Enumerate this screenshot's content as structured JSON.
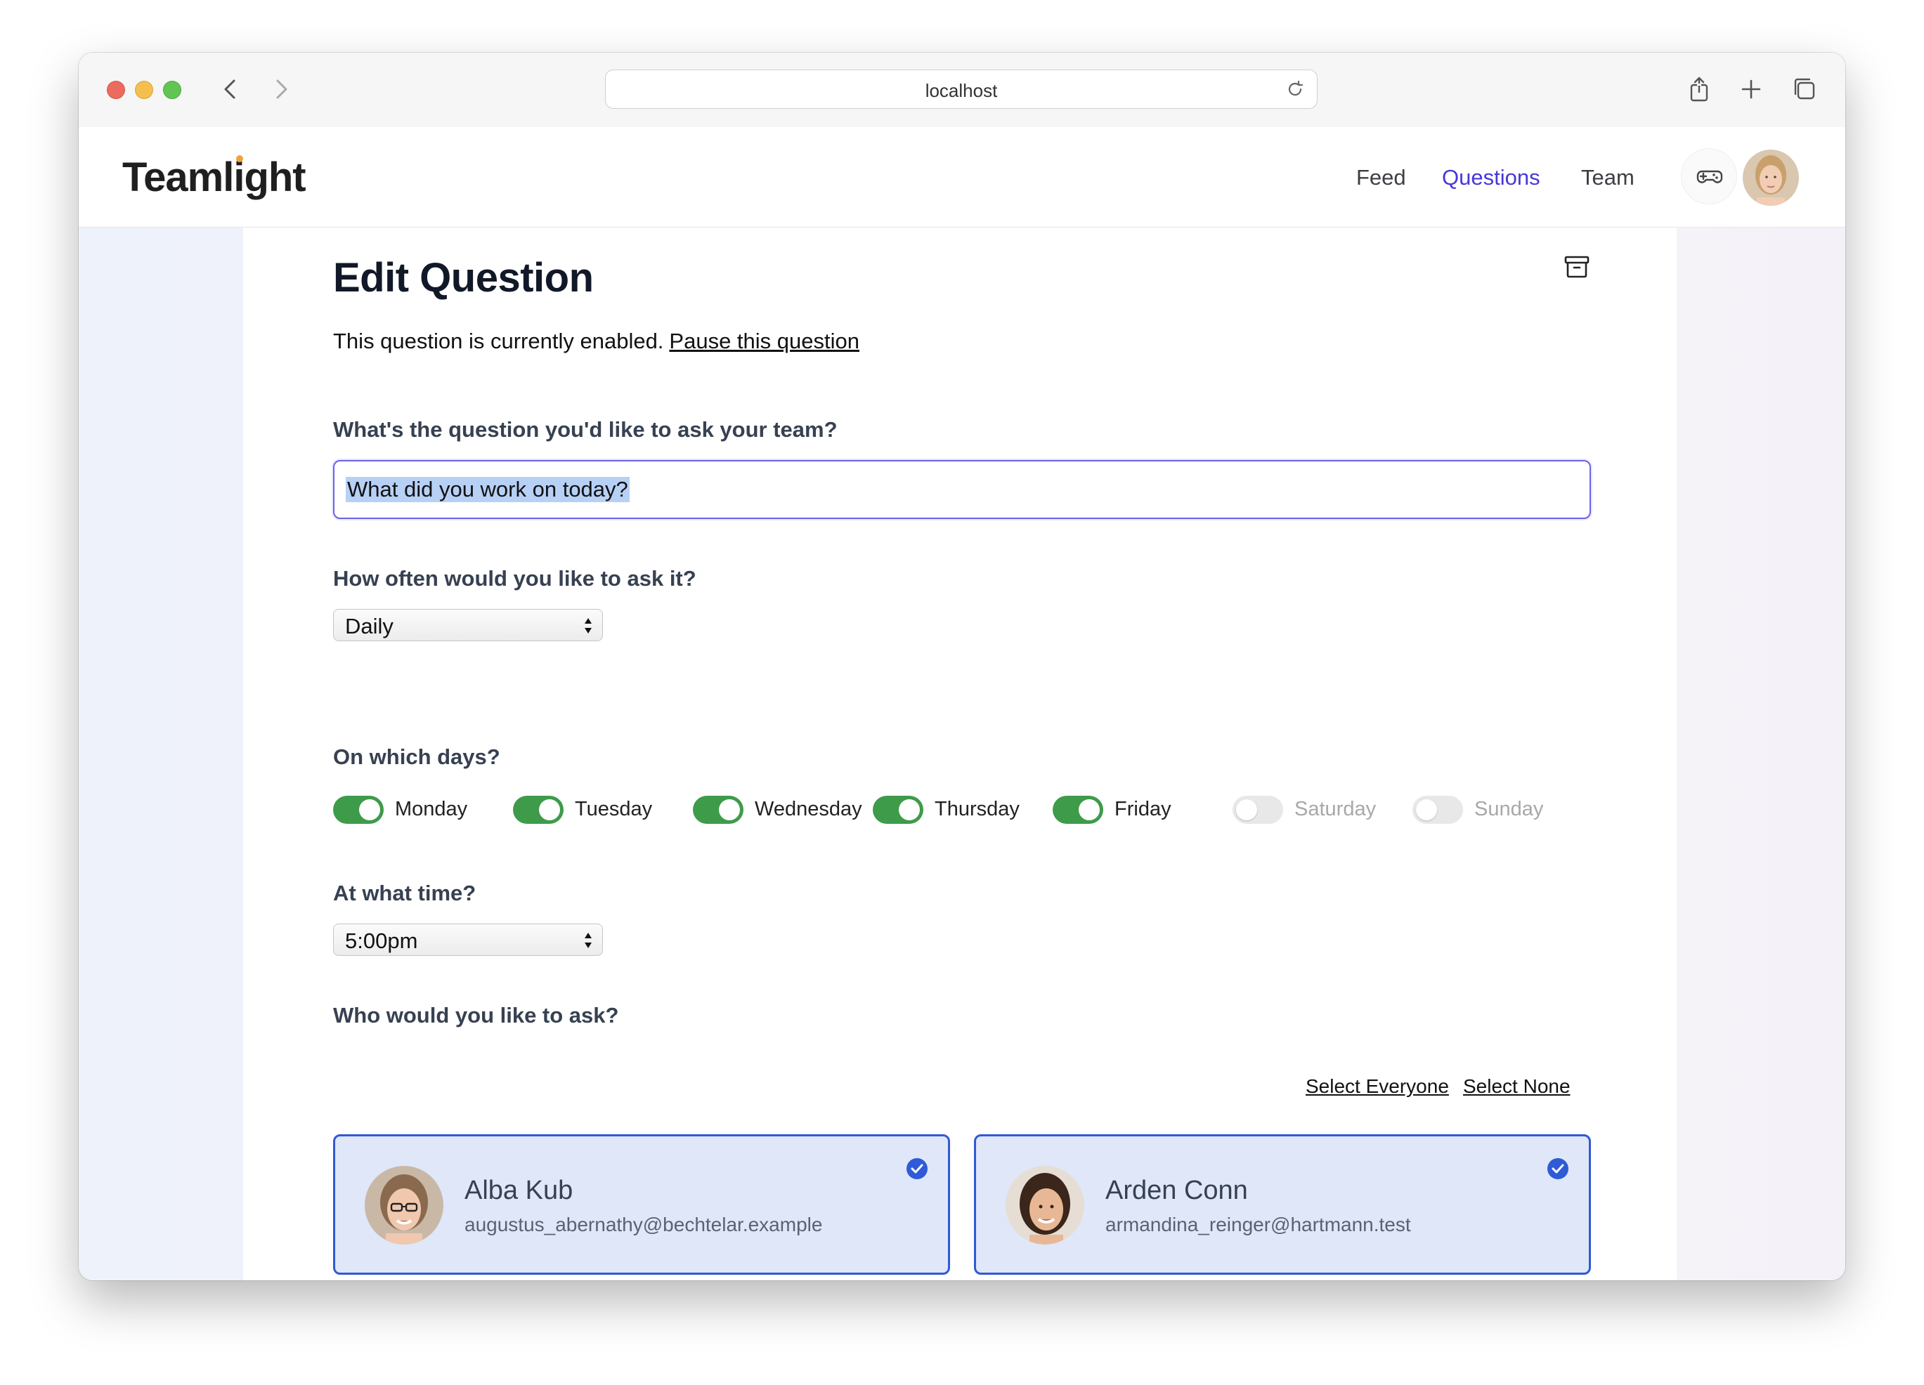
{
  "browser": {
    "url": "localhost"
  },
  "header": {
    "logo": "Teamlight",
    "nav": {
      "feed": "Feed",
      "questions": "Questions",
      "team": "Team"
    },
    "active_color": "#4638d8"
  },
  "page": {
    "title": "Edit Question",
    "status_text": "This question is currently enabled.",
    "pause_link": "Pause this question",
    "question_label": "What's the question you'd like to ask your team?",
    "question_value": "What did you work on today?",
    "frequency_label": "How often would you like to ask it?",
    "frequency_value": "Daily",
    "days_label": "On which days?",
    "days": [
      {
        "label": "Monday",
        "enabled": true
      },
      {
        "label": "Tuesday",
        "enabled": true
      },
      {
        "label": "Wednesday",
        "enabled": true
      },
      {
        "label": "Thursday",
        "enabled": true
      },
      {
        "label": "Friday",
        "enabled": true
      },
      {
        "label": "Saturday",
        "enabled": false
      },
      {
        "label": "Sunday",
        "enabled": false
      }
    ],
    "time_label": "At what time?",
    "time_value": "5:00pm",
    "who_label": "Who would you like to ask?",
    "select_everyone": "Select Everyone",
    "select_none": "Select None",
    "members": [
      {
        "name": "Alba Kub",
        "email": "augustus_abernathy@bechtelar.example",
        "selected": true
      },
      {
        "name": "Arden Conn",
        "email": "armandina_reinger@hartmann.test",
        "selected": true
      },
      {
        "name": "",
        "email": "",
        "selected": true
      },
      {
        "name": "",
        "email": "",
        "selected": true
      }
    ]
  },
  "colors": {
    "toggle_on": "#3e9b4a",
    "card_border": "#3159d4",
    "card_bg": "#dfe7f9"
  }
}
